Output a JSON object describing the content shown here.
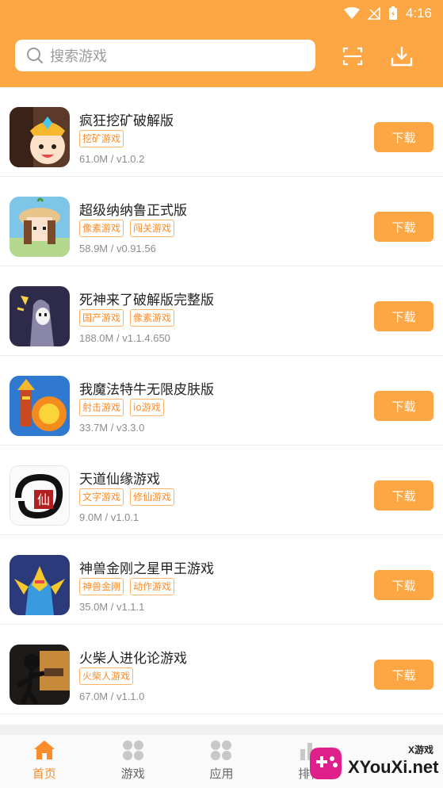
{
  "status": {
    "time": "4:16"
  },
  "search": {
    "placeholder": "搜索游戏"
  },
  "apps": [
    {
      "name": "疯狂挖矿破解版",
      "tags": [
        "挖矿游戏"
      ],
      "meta": "61.0M / v1.0.2",
      "button": "下载"
    },
    {
      "name": "超级纳纳鲁正式版",
      "tags": [
        "像素游戏",
        "闯关游戏"
      ],
      "meta": "58.9M / v0.91.56",
      "button": "下载"
    },
    {
      "name": "死神来了破解版完整版",
      "tags": [
        "国产游戏",
        "像素游戏"
      ],
      "meta": "188.0M / v1.1.4.650",
      "button": "下载"
    },
    {
      "name": "我魔法特牛无限皮肤版",
      "tags": [
        "射击游戏",
        "io游戏"
      ],
      "meta": "33.7M / v3.3.0",
      "button": "下载"
    },
    {
      "name": "天道仙缘游戏",
      "tags": [
        "文字游戏",
        "修仙游戏"
      ],
      "meta": "9.0M / v1.0.1",
      "button": "下载"
    },
    {
      "name": "神兽金刚之星甲王游戏",
      "tags": [
        "神兽金刚",
        "动作游戏"
      ],
      "meta": "35.0M / v1.1.1",
      "button": "下载"
    },
    {
      "name": "火柴人进化论游戏",
      "tags": [
        "火柴人游戏"
      ],
      "meta": "67.0M / v1.1.0",
      "button": "下载"
    }
  ],
  "nav": [
    {
      "label": "首页",
      "icon": "home-icon",
      "active": true
    },
    {
      "label": "游戏",
      "icon": "grid-icon",
      "active": false
    },
    {
      "label": "应用",
      "icon": "grid-icon",
      "active": false
    },
    {
      "label": "排行",
      "icon": "rank-icon",
      "active": false
    }
  ],
  "watermark": {
    "brand": "XYouXi.net",
    "tag": "X游戏"
  },
  "colors": {
    "accent": "#fda644",
    "tag_text": "#fb8c2a",
    "tag_border": "#fdb36a"
  }
}
